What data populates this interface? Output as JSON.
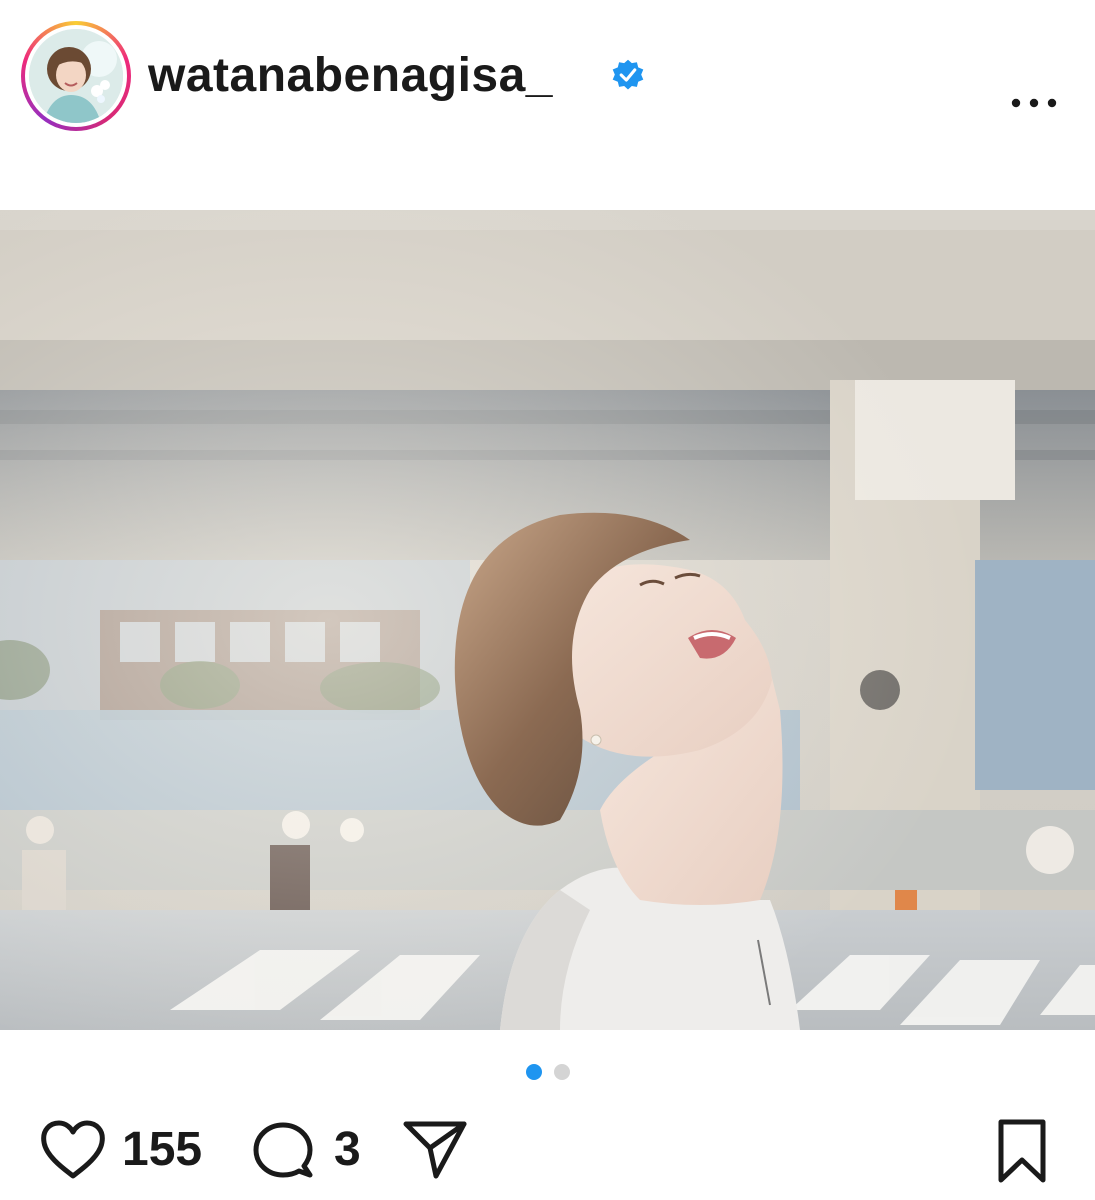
{
  "post": {
    "username": "watanabenagisa_",
    "verified": true,
    "avatar_icon": "profile-avatar",
    "more_icon": "more-dots-icon",
    "image": {
      "description_icon": "post-photo",
      "carousel_count": 2,
      "carousel_active_index": 0
    },
    "likes_count": "155",
    "comments_count": "3"
  },
  "colors": {
    "verified_blue": "#1f95f0",
    "active_dot": "#1f95f0",
    "inactive_dot": "#d4d4d4",
    "text": "#1a1a1a"
  },
  "icons": {
    "like": "heart-icon",
    "comment": "comment-bubble-icon",
    "share": "send-paper-plane-icon",
    "save": "bookmark-icon"
  }
}
